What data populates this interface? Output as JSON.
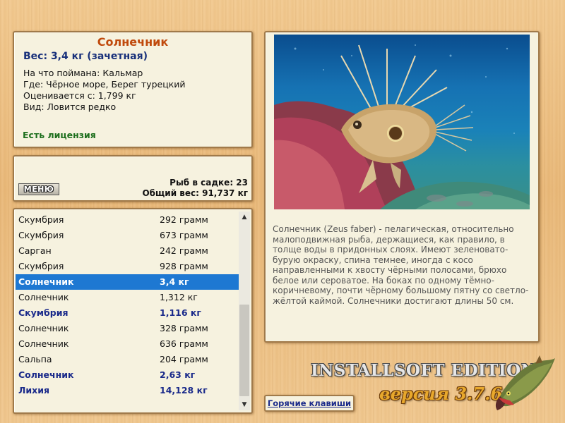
{
  "info": {
    "fish_name": "Солнечник",
    "weight_line": "Вес: 3,4 кг (зачетная)",
    "caught_on": "На что поймана: Кальмар",
    "location": "Где: Чёрное море, Берег турецкий",
    "rated_from": "Оценивается с: 1,799 кг",
    "kind": "Вид: Ловится редко",
    "license": "Есть лицензия"
  },
  "stats": {
    "menu_label": "МЕНЮ",
    "catch_count": "Рыб в садке: 23",
    "total_weight": "Общий вес: 91,737 кг"
  },
  "catch_list": [
    {
      "name": "Скумбрия",
      "weight": "292 грамм",
      "style": "normal"
    },
    {
      "name": "Скумбрия",
      "weight": "673 грамм",
      "style": "normal"
    },
    {
      "name": "Сарган",
      "weight": "242 грамм",
      "style": "normal"
    },
    {
      "name": "Скумбрия",
      "weight": "928 грамм",
      "style": "normal"
    },
    {
      "name": "Солнечник",
      "weight": "3,4 кг",
      "style": "selected"
    },
    {
      "name": "Солнечник",
      "weight": "1,312 кг",
      "style": "normal"
    },
    {
      "name": "Скумбрия",
      "weight": "1,116 кг",
      "style": "bold"
    },
    {
      "name": "Солнечник",
      "weight": "328 грамм",
      "style": "normal"
    },
    {
      "name": "Солнечник",
      "weight": "636 грамм",
      "style": "normal"
    },
    {
      "name": "Сальпа",
      "weight": "204 грамм",
      "style": "normal"
    },
    {
      "name": "Солнечник",
      "weight": "2,63 кг",
      "style": "bold"
    },
    {
      "name": "Лихия",
      "weight": "14,128 кг",
      "style": "bold"
    }
  ],
  "detail": {
    "photo_icon": "fish-photo",
    "description": "Солнечник (Zeus faber) - пелагическая, относительно малоподвижная рыба, держащиеся, как правило, в толще воды в придонных слоях. Имеют зеленовато-бурую окраску, спина темнее, иногда с косо направленными к хвосту чёрными полосами, брюхо белое или сероватое. На боках по одному тёмно-коричневому, почти чёрному большому пятну со светло-жёлтой каймой. Солнечники достигают длины 50 см."
  },
  "footer": {
    "hotkeys_label": "Горячие клавиши",
    "logo_title": "INSTALLSOFT EDITION",
    "logo_version": "версия 3.7.6"
  },
  "colors": {
    "title": "#c04a0c",
    "weight": "#18307a",
    "license": "#1c6e1c",
    "selection": "#1e78d2"
  }
}
